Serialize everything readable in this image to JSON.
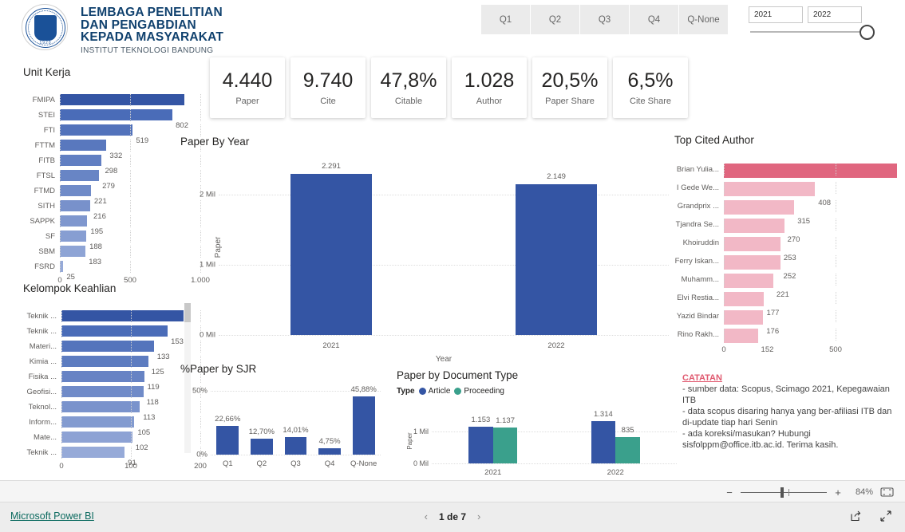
{
  "header": {
    "org_line1": "LEMBAGA PENELITIAN",
    "org_line2": "DAN PENGABDIAN",
    "org_line3": "KEPADA MASYARAKAT",
    "org_sub": "INSTITUT TEKNOLOGI BANDUNG",
    "logo_year": "1920",
    "quartile_buttons": [
      "Q1",
      "Q2",
      "Q3",
      "Q4",
      "Q-None"
    ],
    "year_from": "2021",
    "year_to": "2022"
  },
  "kpis": [
    {
      "value": "4.440",
      "label": "Paper"
    },
    {
      "value": "9.740",
      "label": "Cite"
    },
    {
      "value": "47,8%",
      "label": "Citable"
    },
    {
      "value": "1.028",
      "label": "Author"
    },
    {
      "value": "20,5%",
      "label": "Paper Share"
    },
    {
      "value": "6,5%",
      "label": "Cite Share"
    }
  ],
  "colors": {
    "bar_blue_dark": "#3455a4",
    "bar_blue_mid": "#4a6cb8",
    "bar_blue_light": "#8fa6d8",
    "bar_pink_dark": "#e0667f",
    "bar_pink_light": "#f2b8c6",
    "teal": "#3aa08c",
    "note_red": "#e05a70",
    "brand_navy": "#10416e"
  },
  "chart_data": [
    {
      "type": "bar",
      "orientation": "horizontal",
      "title": "Unit Kerja",
      "xlabel": "",
      "ylabel": "",
      "xlim": [
        0,
        1000
      ],
      "xticks": [
        "0",
        "500",
        "1.000"
      ],
      "xtick_values": [
        0,
        500,
        1000
      ],
      "grid": true,
      "categories": [
        "FMIPA",
        "STEI",
        "FTI",
        "FTTM",
        "FITB",
        "FTSL",
        "FTMD",
        "SITH",
        "SAPPK",
        "SF",
        "SBM",
        "FSRD"
      ],
      "values": [
        889,
        802,
        519,
        332,
        298,
        279,
        221,
        216,
        195,
        188,
        183,
        25
      ],
      "value_labels": [
        "889",
        "802",
        "519",
        "332",
        "298",
        "279",
        "221",
        "216",
        "195",
        "188",
        "183",
        "25"
      ]
    },
    {
      "type": "bar",
      "orientation": "horizontal",
      "title": "Kelompok Keahlian",
      "xlabel": "",
      "ylabel": "",
      "xlim": [
        0,
        200
      ],
      "xticks": [
        "0",
        "100",
        "200"
      ],
      "xtick_values": [
        0,
        100,
        200
      ],
      "grid": true,
      "scrollable": true,
      "categories": [
        "Teknik ...",
        "Teknik ...",
        "Materi...",
        "Kimia ...",
        "Fisika ...",
        "Geofisi...",
        "Teknol...",
        "Inform...",
        "Mate...",
        "Teknik ..."
      ],
      "values": [
        176,
        153,
        133,
        125,
        119,
        118,
        113,
        105,
        102,
        91
      ],
      "value_labels": [
        "176",
        "153",
        "133",
        "125",
        "119",
        "118",
        "113",
        "105",
        "102",
        "91"
      ]
    },
    {
      "type": "bar",
      "orientation": "vertical",
      "title": "Paper By Year",
      "xlabel": "Year",
      "ylabel": "Paper",
      "categories": [
        "2021",
        "2022"
      ],
      "values": [
        2291,
        2149
      ],
      "value_labels": [
        "2.291",
        "2.149"
      ],
      "ylim": [
        0,
        2500
      ],
      "yticks": [
        "0 Mil",
        "1 Mil",
        "2 Mil"
      ],
      "ytick_values": [
        0,
        1000,
        2000
      ],
      "grid": true
    },
    {
      "type": "bar",
      "orientation": "horizontal",
      "title": "Top Cited Author",
      "xlabel": "",
      "ylabel": "",
      "xlim": [
        0,
        800
      ],
      "xticks": [
        "0",
        "500"
      ],
      "xtick_values": [
        0,
        500
      ],
      "grid": true,
      "categories": [
        "Brian Yulia...",
        "I Gede We...",
        "Grandprix ...",
        "Tjandra Se...",
        "Khoiruddin",
        "Ferry Iskan...",
        "Muhamm...",
        "Elvi Restia...",
        "Yazid Bindar",
        "Rino Rakh..."
      ],
      "values": [
        776,
        408,
        315,
        270,
        253,
        252,
        221,
        177,
        176,
        152
      ],
      "value_labels": [
        "776",
        "408",
        "315",
        "270",
        "253",
        "252",
        "221",
        "177",
        "176",
        "152"
      ]
    },
    {
      "type": "bar",
      "orientation": "vertical",
      "title": "%Paper by SJR",
      "xlabel": "",
      "ylabel": "",
      "categories": [
        "Q1",
        "Q2",
        "Q3",
        "Q4",
        "Q-None"
      ],
      "values": [
        22.66,
        12.7,
        14.01,
        4.75,
        45.88
      ],
      "value_labels": [
        "22,66%",
        "12,70%",
        "14,01%",
        "4,75%",
        "45,88%"
      ],
      "ylim": [
        0,
        50
      ],
      "yticks": [
        "0%",
        "50%"
      ],
      "ytick_values": [
        0,
        50
      ],
      "grid": true
    },
    {
      "type": "bar",
      "orientation": "vertical",
      "title": "Paper by Document Type",
      "legend_title": "Type",
      "legend_position": "top",
      "xlabel": "",
      "ylabel": "Paper",
      "categories": [
        "2021",
        "2022"
      ],
      "series": [
        {
          "name": "Article",
          "values": [
            1153,
            1314
          ],
          "value_labels": [
            "1.153",
            "1.314"
          ],
          "color": "#3455a4"
        },
        {
          "name": "Proceeding",
          "values": [
            1137,
            835
          ],
          "value_labels": [
            "1.137",
            "835"
          ],
          "color": "#3aa08c"
        }
      ],
      "ylim": [
        0,
        1400
      ],
      "yticks": [
        "0 Mil",
        "1 Mil"
      ],
      "ytick_values": [
        0,
        1000
      ],
      "grid": true
    }
  ],
  "catatan": {
    "heading": "CATATAN",
    "body": "- sumber data: Scopus, Scimago 2021, Kepegawaian ITB\n- data scopus disaring hanya yang ber-afiliasi ITB dan di-update tiap hari Senin\n- ada koreksi/masukan? Hubungi sisfolppm@office.itb.ac.id. Terima kasih."
  },
  "statusbar": {
    "zoom_minus": "−",
    "zoom_plus": "+",
    "zoom_percent": "84%"
  },
  "footer": {
    "brand": "Microsoft Power BI",
    "prev": "‹",
    "next": "›",
    "page_text": "1 de 7"
  }
}
